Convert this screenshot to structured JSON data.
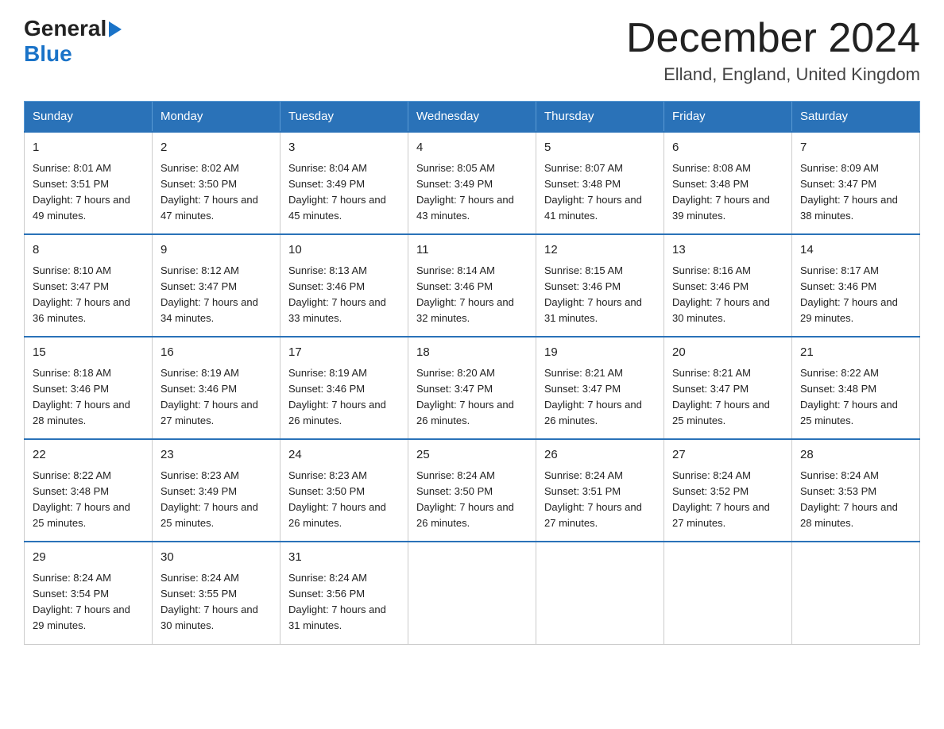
{
  "header": {
    "logo_general": "General",
    "logo_blue": "Blue",
    "title": "December 2024",
    "subtitle": "Elland, England, United Kingdom"
  },
  "days_of_week": [
    "Sunday",
    "Monday",
    "Tuesday",
    "Wednesday",
    "Thursday",
    "Friday",
    "Saturday"
  ],
  "weeks": [
    [
      {
        "day": "1",
        "sunrise": "8:01 AM",
        "sunset": "3:51 PM",
        "daylight": "7 hours and 49 minutes."
      },
      {
        "day": "2",
        "sunrise": "8:02 AM",
        "sunset": "3:50 PM",
        "daylight": "7 hours and 47 minutes."
      },
      {
        "day": "3",
        "sunrise": "8:04 AM",
        "sunset": "3:49 PM",
        "daylight": "7 hours and 45 minutes."
      },
      {
        "day": "4",
        "sunrise": "8:05 AM",
        "sunset": "3:49 PM",
        "daylight": "7 hours and 43 minutes."
      },
      {
        "day": "5",
        "sunrise": "8:07 AM",
        "sunset": "3:48 PM",
        "daylight": "7 hours and 41 minutes."
      },
      {
        "day": "6",
        "sunrise": "8:08 AM",
        "sunset": "3:48 PM",
        "daylight": "7 hours and 39 minutes."
      },
      {
        "day": "7",
        "sunrise": "8:09 AM",
        "sunset": "3:47 PM",
        "daylight": "7 hours and 38 minutes."
      }
    ],
    [
      {
        "day": "8",
        "sunrise": "8:10 AM",
        "sunset": "3:47 PM",
        "daylight": "7 hours and 36 minutes."
      },
      {
        "day": "9",
        "sunrise": "8:12 AM",
        "sunset": "3:47 PM",
        "daylight": "7 hours and 34 minutes."
      },
      {
        "day": "10",
        "sunrise": "8:13 AM",
        "sunset": "3:46 PM",
        "daylight": "7 hours and 33 minutes."
      },
      {
        "day": "11",
        "sunrise": "8:14 AM",
        "sunset": "3:46 PM",
        "daylight": "7 hours and 32 minutes."
      },
      {
        "day": "12",
        "sunrise": "8:15 AM",
        "sunset": "3:46 PM",
        "daylight": "7 hours and 31 minutes."
      },
      {
        "day": "13",
        "sunrise": "8:16 AM",
        "sunset": "3:46 PM",
        "daylight": "7 hours and 30 minutes."
      },
      {
        "day": "14",
        "sunrise": "8:17 AM",
        "sunset": "3:46 PM",
        "daylight": "7 hours and 29 minutes."
      }
    ],
    [
      {
        "day": "15",
        "sunrise": "8:18 AM",
        "sunset": "3:46 PM",
        "daylight": "7 hours and 28 minutes."
      },
      {
        "day": "16",
        "sunrise": "8:19 AM",
        "sunset": "3:46 PM",
        "daylight": "7 hours and 27 minutes."
      },
      {
        "day": "17",
        "sunrise": "8:19 AM",
        "sunset": "3:46 PM",
        "daylight": "7 hours and 26 minutes."
      },
      {
        "day": "18",
        "sunrise": "8:20 AM",
        "sunset": "3:47 PM",
        "daylight": "7 hours and 26 minutes."
      },
      {
        "day": "19",
        "sunrise": "8:21 AM",
        "sunset": "3:47 PM",
        "daylight": "7 hours and 26 minutes."
      },
      {
        "day": "20",
        "sunrise": "8:21 AM",
        "sunset": "3:47 PM",
        "daylight": "7 hours and 25 minutes."
      },
      {
        "day": "21",
        "sunrise": "8:22 AM",
        "sunset": "3:48 PM",
        "daylight": "7 hours and 25 minutes."
      }
    ],
    [
      {
        "day": "22",
        "sunrise": "8:22 AM",
        "sunset": "3:48 PM",
        "daylight": "7 hours and 25 minutes."
      },
      {
        "day": "23",
        "sunrise": "8:23 AM",
        "sunset": "3:49 PM",
        "daylight": "7 hours and 25 minutes."
      },
      {
        "day": "24",
        "sunrise": "8:23 AM",
        "sunset": "3:50 PM",
        "daylight": "7 hours and 26 minutes."
      },
      {
        "day": "25",
        "sunrise": "8:24 AM",
        "sunset": "3:50 PM",
        "daylight": "7 hours and 26 minutes."
      },
      {
        "day": "26",
        "sunrise": "8:24 AM",
        "sunset": "3:51 PM",
        "daylight": "7 hours and 27 minutes."
      },
      {
        "day": "27",
        "sunrise": "8:24 AM",
        "sunset": "3:52 PM",
        "daylight": "7 hours and 27 minutes."
      },
      {
        "day": "28",
        "sunrise": "8:24 AM",
        "sunset": "3:53 PM",
        "daylight": "7 hours and 28 minutes."
      }
    ],
    [
      {
        "day": "29",
        "sunrise": "8:24 AM",
        "sunset": "3:54 PM",
        "daylight": "7 hours and 29 minutes."
      },
      {
        "day": "30",
        "sunrise": "8:24 AM",
        "sunset": "3:55 PM",
        "daylight": "7 hours and 30 minutes."
      },
      {
        "day": "31",
        "sunrise": "8:24 AM",
        "sunset": "3:56 PM",
        "daylight": "7 hours and 31 minutes."
      },
      null,
      null,
      null,
      null
    ]
  ]
}
